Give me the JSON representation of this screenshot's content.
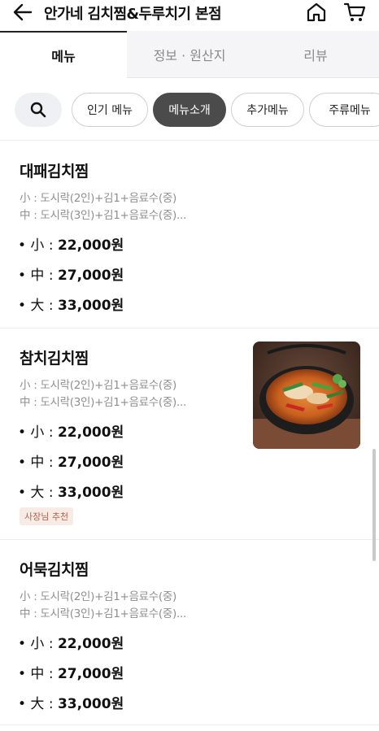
{
  "header": {
    "title": "안가네 김치찜&두루치기 본점",
    "icons": [
      "back-arrow-icon",
      "home-icon",
      "cart-icon"
    ]
  },
  "tabs": [
    {
      "label": "메뉴",
      "active": true
    },
    {
      "label": "정보 · 원산지",
      "active": false
    },
    {
      "label": "리뷰",
      "active": false
    }
  ],
  "chips": [
    {
      "label": "인기 메뉴",
      "active": false
    },
    {
      "label": "메뉴소개",
      "active": true
    },
    {
      "label": "추가메뉴",
      "active": false
    },
    {
      "label": "주류메뉴",
      "active": false
    }
  ],
  "menu": [
    {
      "name": "대패김치찜",
      "desc_lines": [
        "小 : 도시락(2인)+김1+음료수(중)",
        "中 : 도시락(3인)+김1+음료수(중)..."
      ],
      "prices": [
        {
          "size": "• 小 : ",
          "amount": "22,000원"
        },
        {
          "size": "• 中 : ",
          "amount": "27,000원"
        },
        {
          "size": "• 大 : ",
          "amount": "33,000원"
        }
      ]
    },
    {
      "name": "참치김치찜",
      "desc_lines": [
        "小 : 도시락(2인)+김1+음료수(중)",
        "中 : 도시락(3인)+김1+음료수(중)..."
      ],
      "prices": [
        {
          "size": "• 小 : ",
          "amount": "22,000원"
        },
        {
          "size": "• 中 : ",
          "amount": "27,000원"
        },
        {
          "size": "• 大 : ",
          "amount": "33,000원"
        }
      ],
      "badge": "사장님 추천"
    },
    {
      "name": "어묵김치찜",
      "desc_lines": [
        "小 : 도시락(2인)+김1+음료수(중)",
        "中 : 도시락(3인)+김1+음료수(중)..."
      ],
      "prices": [
        {
          "size": "• 小 : ",
          "amount": "22,000원"
        },
        {
          "size": "• 中 : ",
          "amount": "27,000원"
        },
        {
          "size": "• 大 : ",
          "amount": "33,000원"
        }
      ]
    }
  ],
  "colors": {
    "active_chip": "#4b4b4b",
    "badge_bg": "#f7ebe6",
    "badge_text": "#b3624a",
    "inactive_tab_bg": "#f5f5f7"
  }
}
